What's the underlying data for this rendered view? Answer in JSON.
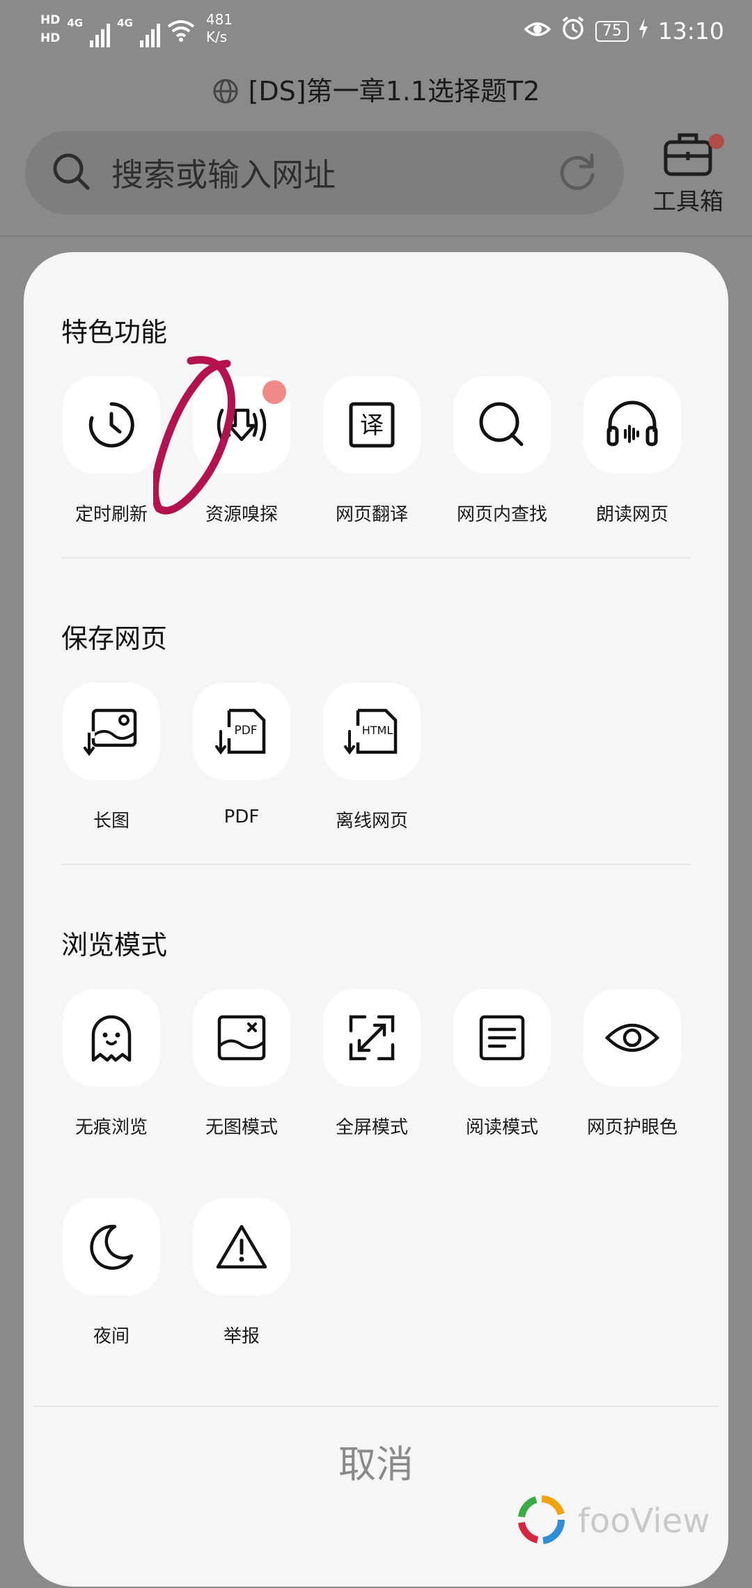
{
  "status_bar": {
    "hd1": "HD",
    "hd2": "HD",
    "net1": "4G",
    "net2": "4G",
    "speed_value": "481",
    "speed_unit": "K/s",
    "battery": "75",
    "time": "13:10"
  },
  "page_title": "[DS]第一章1.1选择题T2",
  "search": {
    "placeholder": "搜索或输入网址"
  },
  "toolbox": {
    "label": "工具箱",
    "has_notification": true
  },
  "sections": [
    {
      "title": "特色功能",
      "items": [
        {
          "label": "定时刷新",
          "icon": "timer-refresh-icon"
        },
        {
          "label": "资源嗅探",
          "icon": "resource-sniff-icon",
          "badge": true
        },
        {
          "label": "网页翻译",
          "icon": "translate-icon"
        },
        {
          "label": "网页内查找",
          "icon": "find-in-page-icon"
        },
        {
          "label": "朗读网页",
          "icon": "headphones-icon"
        }
      ]
    },
    {
      "title": "保存网页",
      "items": [
        {
          "label": "长图",
          "icon": "long-image-icon"
        },
        {
          "label": "PDF",
          "icon": "pdf-icon"
        },
        {
          "label": "离线网页",
          "icon": "html-offline-icon"
        }
      ]
    },
    {
      "title": "浏览模式",
      "items": [
        {
          "label": "无痕浏览",
          "icon": "ghost-icon"
        },
        {
          "label": "无图模式",
          "icon": "no-image-icon"
        },
        {
          "label": "全屏模式",
          "icon": "fullscreen-icon"
        },
        {
          "label": "阅读模式",
          "icon": "reader-mode-icon"
        },
        {
          "label": "网页护眼色",
          "icon": "eye-icon"
        },
        {
          "label": "夜间",
          "icon": "moon-icon"
        },
        {
          "label": "举报",
          "icon": "warning-icon"
        }
      ]
    }
  ],
  "cancel_label": "取消",
  "icon_text": {
    "translate": "译",
    "pdf": "PDF",
    "html": "HTML"
  },
  "watermark": "fooView",
  "colors": {
    "annotation": "#b3124f",
    "badge": "#f08a86",
    "sheet": "#f6f6f6",
    "tile": "#ffffff"
  }
}
